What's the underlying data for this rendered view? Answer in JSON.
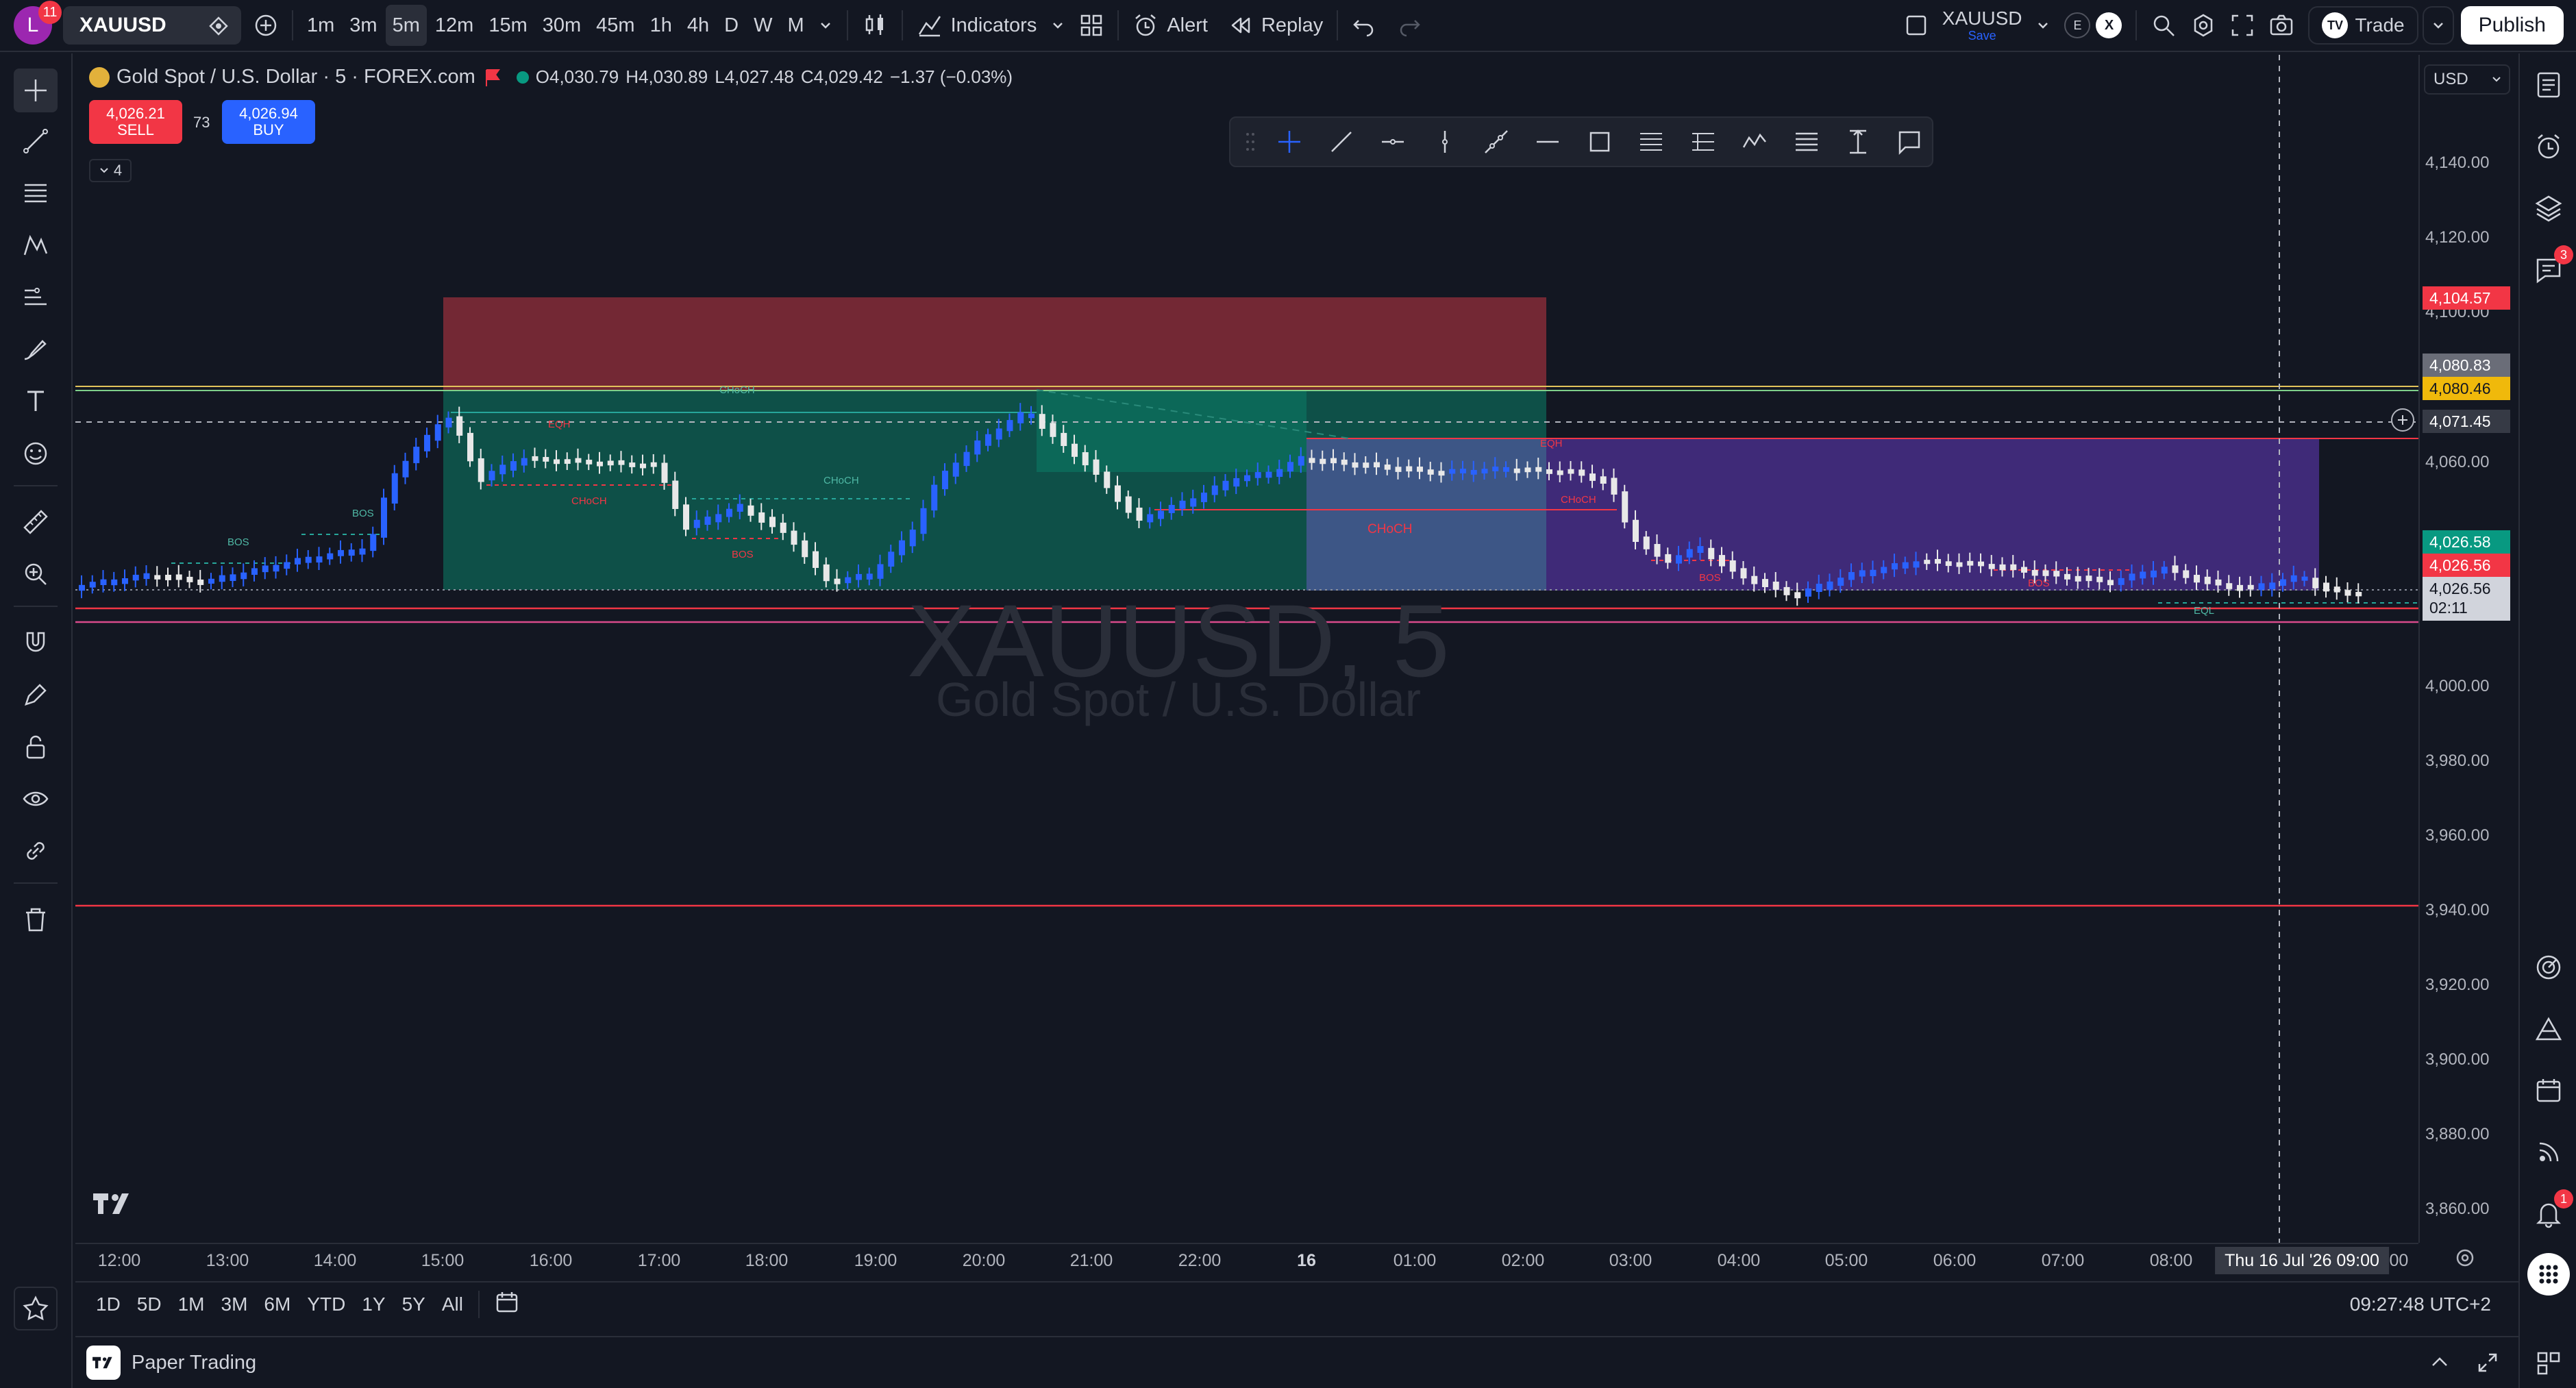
{
  "topbar": {
    "avatar_letter": "L",
    "avatar_badge": "11",
    "symbol": "XAUUSD",
    "intervals": [
      "1m",
      "3m",
      "5m",
      "12m",
      "15m",
      "30m",
      "45m",
      "1h",
      "4h",
      "D",
      "W",
      "M"
    ],
    "active_interval": "5m",
    "indicators_label": "Indicators",
    "alert_label": "Alert",
    "replay_label": "Replay",
    "layout_name": "XAUUSD",
    "layout_save": "Save",
    "exchange_e": "E",
    "exchange_x": "X",
    "trade_label": "Trade",
    "publish_label": "Publish"
  },
  "legend": {
    "title": "Gold Spot / U.S. Dollar · 5 · FOREX.com",
    "open": "O4,030.79",
    "high": "H4,030.89",
    "low": "L4,027.48",
    "close": "C4,029.42",
    "change": "−1.37 (−0.03%)",
    "sell_price": "4,026.21",
    "sell_label": "SELL",
    "spread": "73",
    "buy_price": "4,026.94",
    "buy_label": "BUY",
    "indicator_count": "4"
  },
  "watermark": {
    "symbol": "XAUUSD, 5",
    "name": "Gold Spot / U.S. Dollar"
  },
  "price_axis": {
    "currency": "USD",
    "labels": [
      "4,140.00",
      "4,120.00",
      "4,100.00",
      "4,060.00",
      "4,000.00",
      "3,980.00",
      "3,960.00",
      "3,940.00",
      "3,920.00",
      "3,900.00",
      "3,880.00",
      "3,860.00"
    ],
    "tag_red_top": "4,104.57",
    "tag_gray": "4,080.83",
    "tag_yellow": "4,080.46",
    "tag_cross": "4,071.45",
    "tag_green": "4,026.58",
    "tag_red": "4,026.56",
    "tag_last": "4,026.56",
    "tag_countdown": "02:11"
  },
  "time_axis": {
    "labels": [
      "12:00",
      "13:00",
      "14:00",
      "15:00",
      "16:00",
      "17:00",
      "18:00",
      "19:00",
      "20:00",
      "21:00",
      "22:00",
      "16",
      "01:00",
      "02:00",
      "03:00",
      "04:00",
      "05:00",
      "06:00",
      "07:00",
      "08:00",
      "10:00"
    ],
    "crosshair_time": "Thu 16 Jul '26  09:00"
  },
  "chart_labels": {
    "choch_top": "CHoCH",
    "eqh_1": "EQH",
    "choch_mid": "CHoCH",
    "choch_red": "CHoCH",
    "bos_green_1": "BOS",
    "bos_green_2": "BOS",
    "bos_red_1": "BOS",
    "choch_purple": "CHoCH",
    "eqh_2": "EQH",
    "choch_red_2": "CHoCH",
    "bos_red_2": "BOS",
    "bos_red_3": "BOS",
    "eql": "EQL"
  },
  "range_bar": {
    "ranges": [
      "1D",
      "5D",
      "1M",
      "3M",
      "6M",
      "YTD",
      "1Y",
      "5Y",
      "All"
    ],
    "clock": "09:27:48 UTC+2"
  },
  "bottom_bar": {
    "paper_trading": "Paper Trading"
  },
  "right_toolbar": {
    "chat_badge": "3",
    "alert_badge": "1"
  },
  "colors": {
    "background": "#131722",
    "up_candle": "#2962ff",
    "down_candle": "#ffffff",
    "red_zone": "#7e2a36",
    "green_zone": "#0e5a4f",
    "purple_zone": "#4b2f8f",
    "accent_red": "#f23645",
    "accent_green": "#089981"
  }
}
